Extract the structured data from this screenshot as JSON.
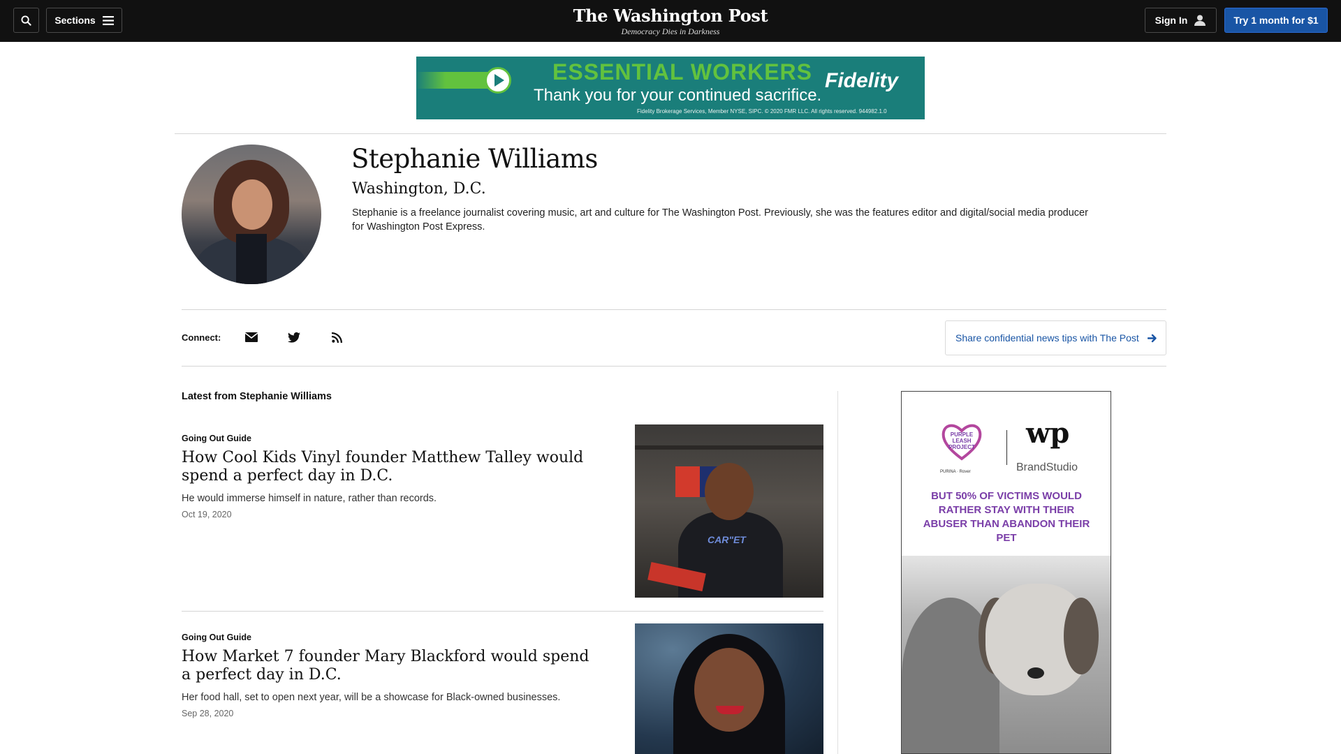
{
  "header": {
    "sections_label": "Sections",
    "logo": "The Washington Post",
    "tagline": "Democracy Dies in Darkness",
    "signin_label": "Sign In",
    "trial_label": "Try 1 month for $1"
  },
  "top_ad": {
    "headline": "ESSENTIAL WORKERS",
    "subline": "Thank you for your continued sacrifice.",
    "brand": "Fidelity",
    "fine_print": "Fidelity Brokerage Services, Member NYSE, SIPC. © 2020 FMR LLC. All rights reserved. 944982.1.0"
  },
  "author": {
    "name": "Stephanie Williams",
    "location": "Washington, D.C.",
    "bio": "Stephanie is a freelance journalist covering music, art and culture for The Washington Post. Previously, she was the features editor and digital/social media producer for Washington Post Express."
  },
  "connect": {
    "label": "Connect:",
    "tips_label": "Share confidential news tips with The Post"
  },
  "latest": {
    "title": "Latest from Stephanie Williams",
    "stories": [
      {
        "kicker": "Going Out Guide",
        "title": "How Cool Kids Vinyl founder Matthew Talley would spend a perfect day in D.C.",
        "blurb": "He would immerse himself in nature, rather than records.",
        "date": "Oct 19, 2020"
      },
      {
        "kicker": "Going Out Guide",
        "title": "How Market 7 founder Mary Blackford would spend a perfect day in D.C.",
        "blurb": "Her food hall, set to open next year, will be a showcase for Black-owned businesses.",
        "date": "Sep 28, 2020"
      }
    ]
  },
  "story_images": {
    "first_logo_text": "CAR\"ET"
  },
  "side_ad": {
    "org": "PURPLE LEASH PROJECT",
    "partner": "PURINA · Rover",
    "wp_logo": "wp",
    "brand_studio": "BrandStudio",
    "message": "BUT 50% OF VICTIMS WOULD RATHER STAY WITH THEIR ABUSER THAN ABANDON THEIR PET"
  },
  "colors": {
    "topbar": "#111111",
    "accent_blue": "#1955a5",
    "ad_teal": "#1a7e7a",
    "ad_green": "#62c23e",
    "purple": "#7a3ea8"
  }
}
